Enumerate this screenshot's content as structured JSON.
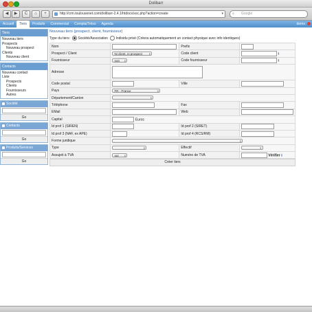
{
  "window": {
    "title": "Dolibarr"
  },
  "browser": {
    "url": "http://crm.toulousenet.com/dolibarr-2.4.1/htdocs/soc.php?action=create",
    "search_placeholder": "Google",
    "back": "◀",
    "forward": "▶",
    "reload": "C",
    "add": "+"
  },
  "nav": {
    "items": [
      "Accueil",
      "Tiers",
      "Produits",
      "Commercial",
      "Compta/Tréso",
      "Agenda"
    ],
    "user": "demo"
  },
  "sidebar": {
    "tiers": {
      "head": "Tiers",
      "items": [
        "Nouveau tiers",
        "Prospects",
        "Nouveau prospect",
        "Clients",
        "Nouveau client"
      ]
    },
    "contacts": {
      "head": "Contacts",
      "items": [
        "Nouveau contact",
        "Liste",
        "Prospects",
        "Clients",
        "Fournisseurs",
        "Autres"
      ]
    },
    "search": [
      {
        "head": "Société",
        "go": "Go"
      },
      {
        "head": "Contacts",
        "go": "Go"
      },
      {
        "head": "Produits/Services",
        "go": "Go"
      }
    ]
  },
  "main": {
    "title": "Nouveau tiers (prospect, client, fournisseur)",
    "type_label": "Type du tiers:",
    "type_option1": "Société/Association",
    "type_option2": "Individu privé (Créera automatiquement un contact physique avec info identiques)",
    "form": {
      "nom": "Nom",
      "prefix": "Prefix",
      "prospect_client": "Prospect / Client",
      "prospect_client_value": "Ni client, ni prospect",
      "code_client": "Code client",
      "fournisseur": "Fournisseur",
      "fournisseur_value": "non",
      "code_fournisseur": "Code fournisseur",
      "adresse": "Adresse",
      "code_postal": "Code postal",
      "ville": "Ville",
      "pays": "Pays",
      "pays_value": "FR - France",
      "departement": "Département/Canton",
      "telephone": "Téléphone",
      "fax": "Fax",
      "email": "EMail",
      "web": "Web",
      "capital": "Capital",
      "euros": "Euros",
      "idprof1": "Id prof 1 (SIREN)",
      "idprof2": "Id prof 2 (SIRET)",
      "idprof3": "Id prof 3 (NAF, ex APE)",
      "idprof4": "Id prof 4 (RCS/RM)",
      "forme_juridique": "Forme juridique",
      "type": "Type",
      "effectif": "Effectif",
      "assujetti_tva": "Assujeti à TVA",
      "assujetti_value": "oui",
      "numero_tva": "Numéro de TVA",
      "verifier": "Vérifier",
      "submit": "Créer tiers"
    }
  }
}
